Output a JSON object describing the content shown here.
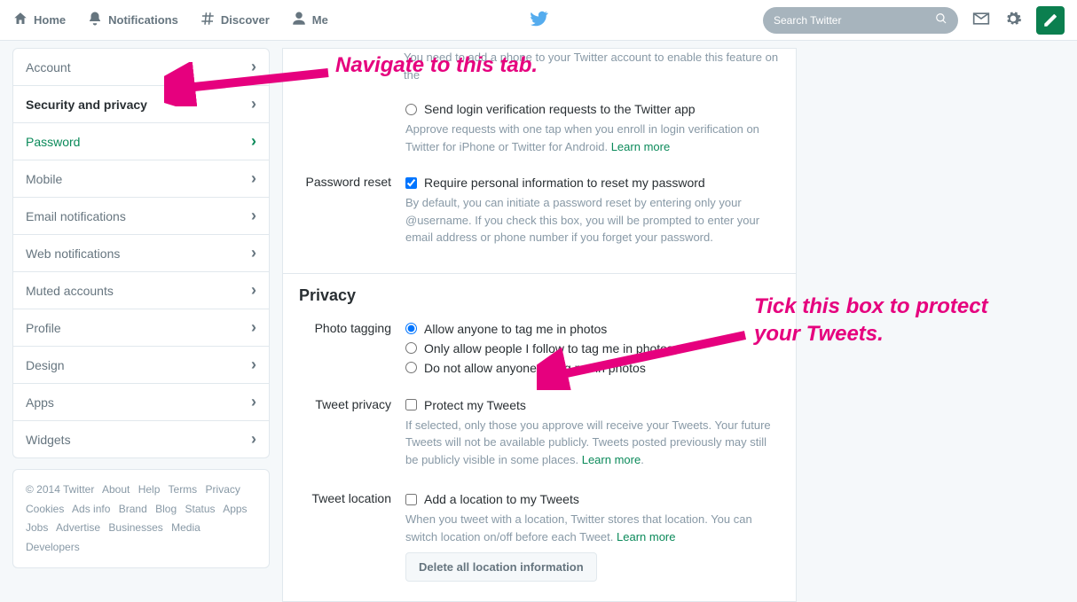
{
  "nav": {
    "home": "Home",
    "notifications": "Notifications",
    "discover": "Discover",
    "me": "Me",
    "search_placeholder": "Search Twitter"
  },
  "sidebar": {
    "items": [
      {
        "label": "Account"
      },
      {
        "label": "Security and privacy"
      },
      {
        "label": "Password"
      },
      {
        "label": "Mobile"
      },
      {
        "label": "Email notifications"
      },
      {
        "label": "Web notifications"
      },
      {
        "label": "Muted accounts"
      },
      {
        "label": "Profile"
      },
      {
        "label": "Design"
      },
      {
        "label": "Apps"
      },
      {
        "label": "Widgets"
      }
    ]
  },
  "footer": {
    "copyright": "© 2014 Twitter",
    "links": [
      "About",
      "Help",
      "Terms",
      "Privacy",
      "Cookies",
      "Ads info",
      "Brand",
      "Blog",
      "Status",
      "Apps",
      "Jobs",
      "Advertise",
      "Businesses",
      "Media",
      "Developers"
    ]
  },
  "settings": {
    "top_note_pre": "You need to ",
    "top_note_link": "add a phone",
    "top_note_post": " to your Twitter account to enable this feature on the",
    "login_verify_label": "Send login verification requests to the Twitter app",
    "login_verify_help": "Approve requests with one tap when you enroll in login verification on Twitter for iPhone or Twitter for Android. ",
    "learn_more": "Learn more",
    "pwd_row_label": "Password reset",
    "pwd_check_label": "Require personal information to reset my password",
    "pwd_help": "By default, you can initiate a password reset by entering only your @username. If you check this box, you will be prompted to enter your email address or phone number if you forget your password.",
    "privacy_heading": "Privacy",
    "photo_row_label": "Photo tagging",
    "photo_opt1": "Allow anyone to tag me in photos",
    "photo_opt2": "Only allow people I follow to tag me in photos",
    "photo_opt3": "Do not allow anyone to tag me in photos",
    "tweet_priv_label": "Tweet privacy",
    "tweet_priv_check": "Protect my Tweets",
    "tweet_priv_help": "If selected, only those you approve will receive your Tweets. Your future Tweets will not be available publicly. Tweets posted previously may still be publicly visible in some places. ",
    "tweet_loc_label": "Tweet location",
    "tweet_loc_check": "Add a location to my Tweets",
    "tweet_loc_help": "When you tweet with a location, Twitter stores that location. You can switch location on/off before each Tweet. ",
    "delete_loc_btn": "Delete all location information"
  },
  "annotations": {
    "a1": "Navigate to this tab.",
    "a2": "Tick this box to protect your Tweets."
  }
}
